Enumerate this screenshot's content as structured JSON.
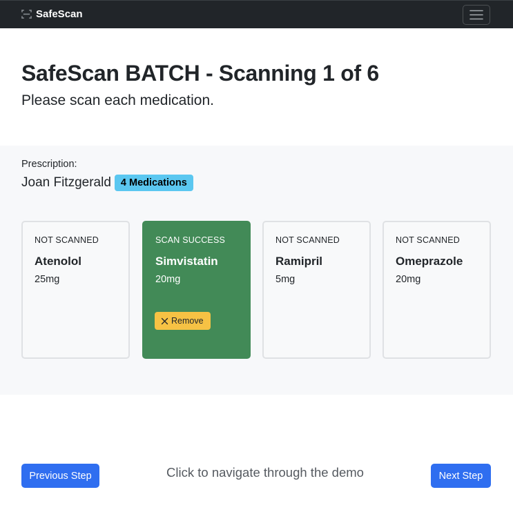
{
  "navbar": {
    "brand": "SafeScan",
    "brand_icon": "scan-icon",
    "menu_icon": "hamburger-menu-icon"
  },
  "header": {
    "title": "SafeScan BATCH - Scanning 1 of 6",
    "subtitle": "Please scan each medication."
  },
  "prescription": {
    "label": "Prescription:",
    "patient": "Joan Fitzgerald",
    "badge": "4 Medications",
    "badge_color": "#5bc7f0"
  },
  "medications": [
    {
      "status": "NOT SCANNED",
      "name": "Atenolol",
      "dose": "25mg"
    },
    {
      "status": "SCAN SUCCESS",
      "name": "Simvistatin",
      "dose": "20mg",
      "action": "Remove",
      "color": "#428a57"
    },
    {
      "status": "NOT SCANNED",
      "name": "Ramipril",
      "dose": "5mg"
    },
    {
      "status": "NOT SCANNED",
      "name": "Omeprazole",
      "dose": "20mg"
    }
  ],
  "footer": {
    "prev": "Previous Step",
    "hint": "Click to navigate through the demo",
    "next": "Next Step",
    "accent": "#2f6ef0"
  }
}
